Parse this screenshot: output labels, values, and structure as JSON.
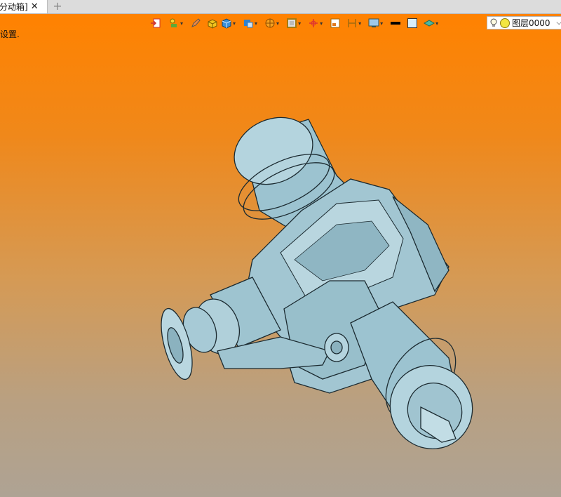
{
  "tab": {
    "title": "分动箱]",
    "close_glyph": "✕",
    "add_glyph": "+"
  },
  "status": {
    "text": "设置."
  },
  "toolbar": {
    "items": [
      {
        "icon": "exit-sketch-icon",
        "dropdown": false
      },
      {
        "icon": "sketch-tools-icon",
        "dropdown": true
      },
      {
        "icon": "pencil-icon",
        "dropdown": false
      },
      {
        "icon": "box-yellow-icon",
        "dropdown": false
      },
      {
        "icon": "cube-blue-icon",
        "dropdown": true
      },
      {
        "icon": "view-orientation-icon",
        "dropdown": true
      },
      {
        "icon": "render-mode-icon",
        "dropdown": true
      },
      {
        "icon": "display-style-icon",
        "dropdown": true
      },
      {
        "icon": "triad-icon",
        "dropdown": true
      },
      {
        "icon": "section-icon",
        "dropdown": false
      },
      {
        "icon": "dimension-icon",
        "dropdown": true
      },
      {
        "icon": "screen-icon",
        "dropdown": true
      },
      {
        "icon": "line-color-icon",
        "dropdown": false
      },
      {
        "icon": "fill-color-icon",
        "dropdown": false
      },
      {
        "icon": "layer-stack-icon",
        "dropdown": true
      }
    ]
  },
  "layer": {
    "name": "图层0000",
    "arrow": "⌵"
  },
  "colors": {
    "bg_top": "#ff8200",
    "bg_bottom": "#aea394",
    "model": "#a7cad6",
    "model_edge": "#1b2a30"
  }
}
